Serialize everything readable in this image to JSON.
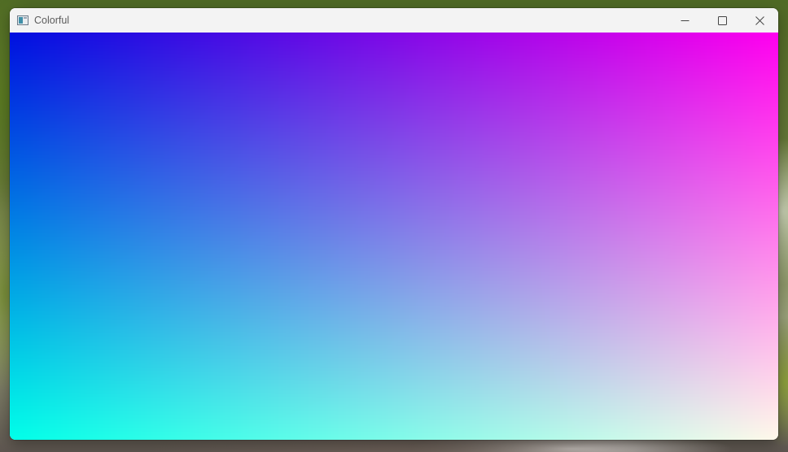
{
  "window": {
    "title": "Colorful"
  },
  "icons": {
    "app": "window-app-icon",
    "minimize": "minimize-icon",
    "maximize": "maximize-icon",
    "close": "close-icon"
  },
  "canvas": {
    "corner_colors": {
      "top_left": "#0010e0",
      "top_right": "#ff00ee",
      "bottom_left": "#00ffe8",
      "bottom_right": "#fff8ea"
    }
  }
}
